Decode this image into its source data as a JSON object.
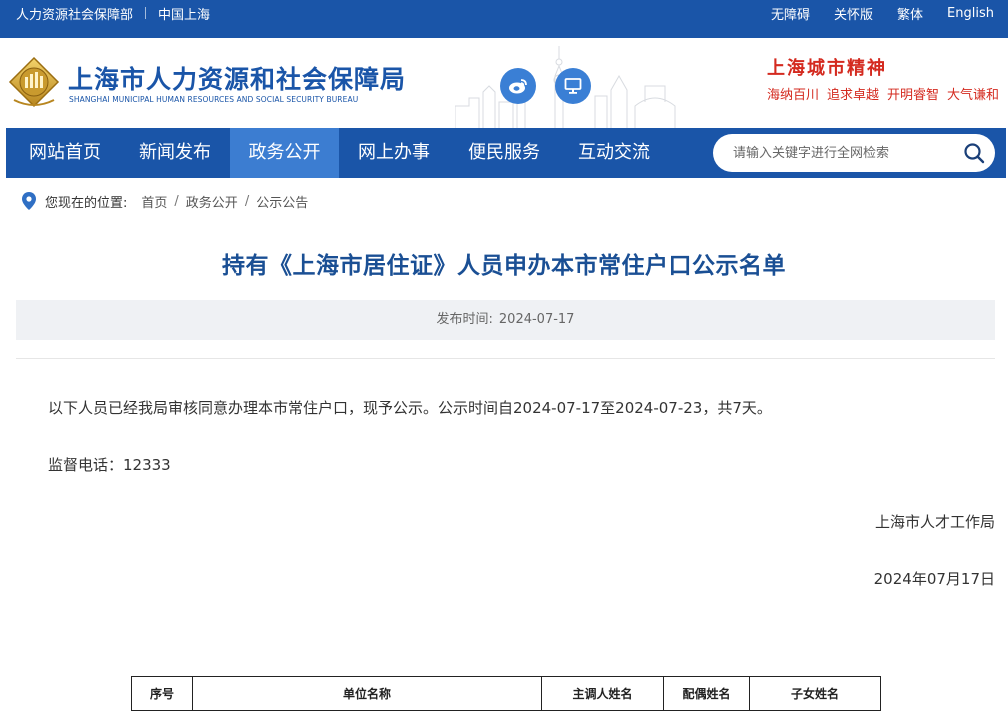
{
  "topbar": {
    "org_link": "人力资源社会保障部",
    "region_link": "中国上海",
    "accessibility": "无障碍",
    "elderly": "关怀版",
    "traditional": "繁体",
    "english": "English"
  },
  "header": {
    "title": "上海市人力资源和社会保障局",
    "subtitle": "SHANGHAI MUNICIPAL HUMAN RESOURCES AND SOCIAL SECURITY BUREAU",
    "logo_icon": "bureau-emblem-icon",
    "weibo_icon": "weibo-icon",
    "pc_icon": "desktop-icon",
    "spirit_title": "上海城市精神",
    "spirit_words": [
      "海纳百川",
      "追求卓越",
      "开明睿智",
      "大气谦和"
    ]
  },
  "nav": {
    "items": [
      {
        "label": "网站首页",
        "active": false
      },
      {
        "label": "新闻发布",
        "active": false
      },
      {
        "label": "政务公开",
        "active": true
      },
      {
        "label": "网上办事",
        "active": false
      },
      {
        "label": "便民服务",
        "active": false
      },
      {
        "label": "互动交流",
        "active": false
      }
    ],
    "search_placeholder": "请输入关键字进行全网检索"
  },
  "breadcrumb": {
    "lead": "您现在的位置:",
    "items": [
      "首页",
      "政务公开",
      "公示公告"
    ]
  },
  "article": {
    "title": "持有《上海市居住证》人员申办本市常住户口公示名单",
    "publish_label": "发布时间:",
    "publish_date": "2024-07-17",
    "paragraph_1": "以下人员已经我局审核同意办理本市常住户口，现予公示。公示时间自2024-07-17至2024-07-23，共7天。",
    "paragraph_2": "监督电话：12333",
    "signature_org": "上海市人才工作局",
    "signature_date": "2024年07月17日"
  },
  "table": {
    "headers": [
      "序号",
      "单位名称",
      "主调人姓名",
      "配偶姓名",
      "子女姓名"
    ]
  },
  "colors": {
    "brand_blue": "#1a55a8",
    "nav_active": "#3c7dd1",
    "title_blue": "#1a4f94",
    "spirit_red": "#d42a1f"
  }
}
